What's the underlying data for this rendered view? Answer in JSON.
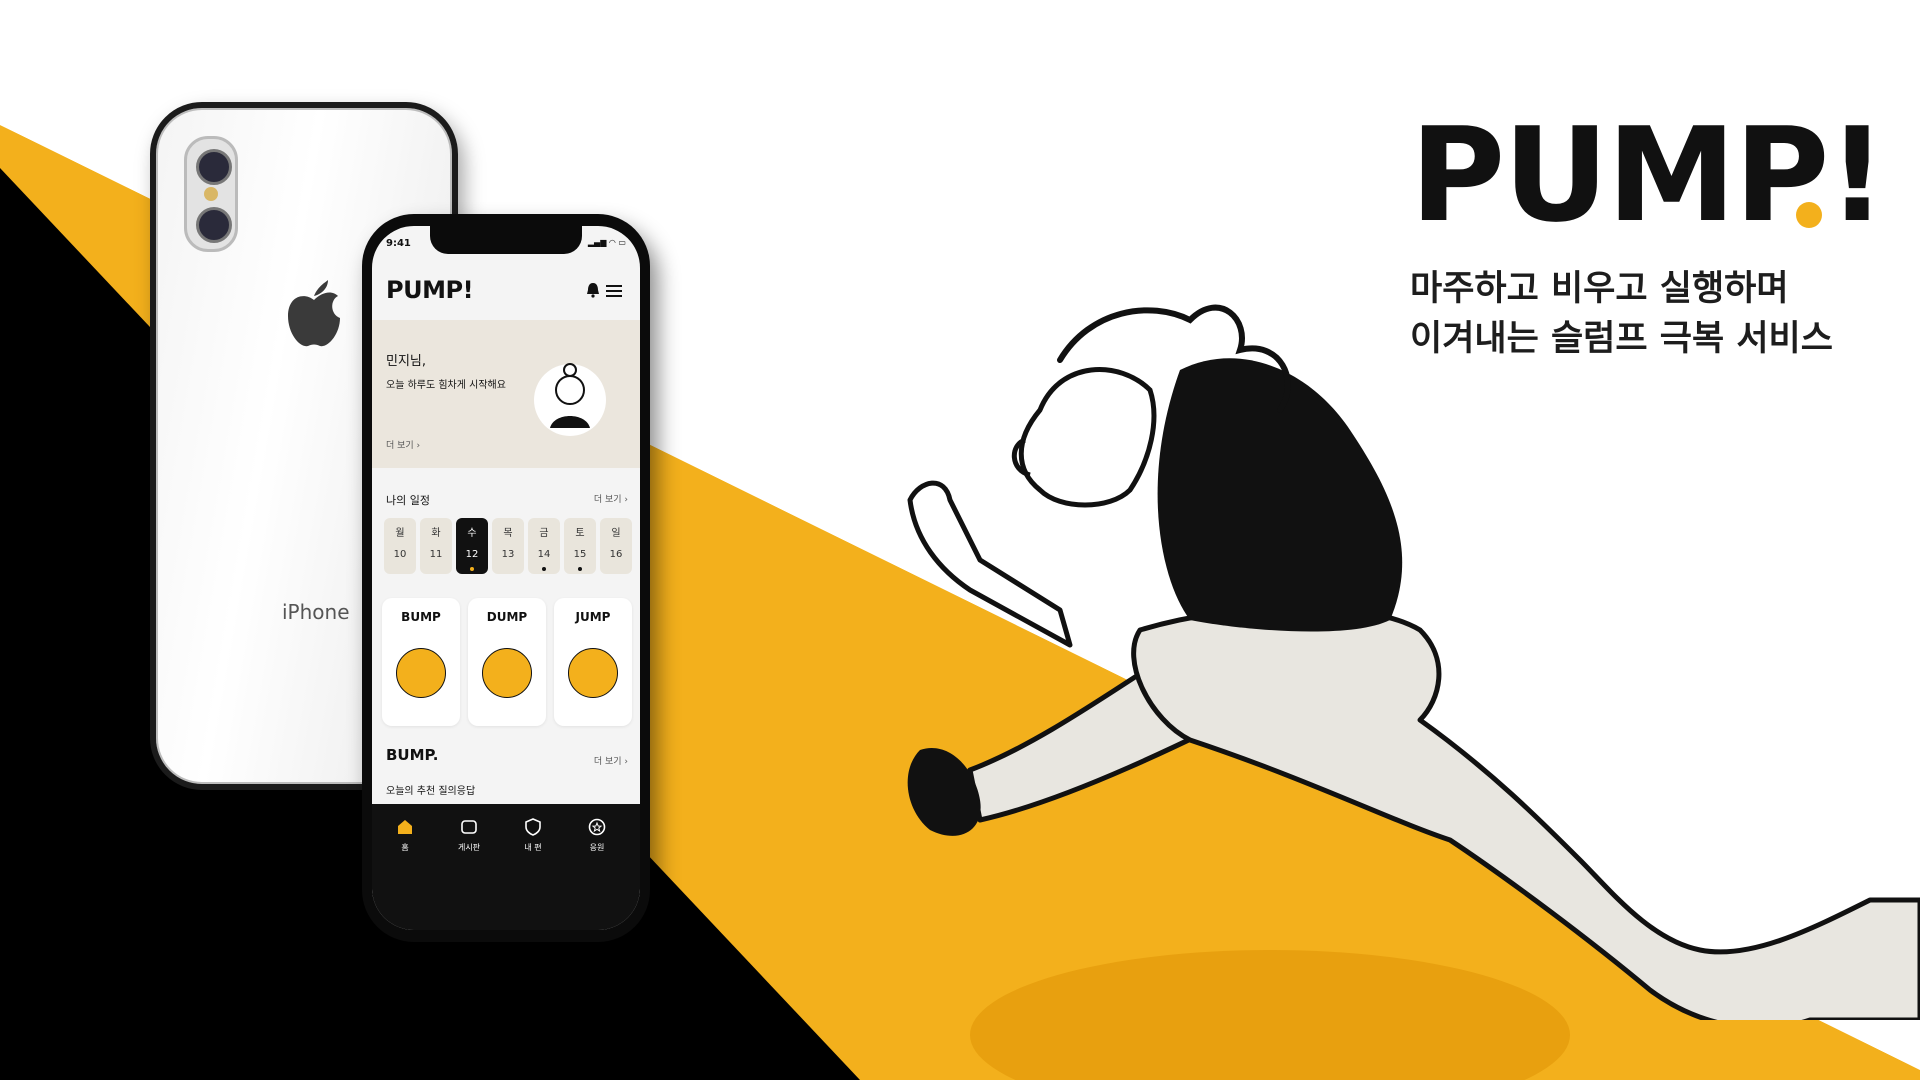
{
  "brand": {
    "logo": "PUMP",
    "logo_mark": "!",
    "tagline_line1": "마주하고 비우고 실행하며",
    "tagline_line2": "이겨내는 슬럼프 극복 서비스"
  },
  "colors": {
    "accent": "#f3b01c",
    "ink": "#111111",
    "cream": "#ebe6dd"
  },
  "back_phone": {
    "label": "iPhone"
  },
  "app": {
    "status_time": "9:41",
    "logo": "PUMP",
    "logo_mark": "!",
    "greeting": {
      "name": "민지님,",
      "message": "오늘 하루도 힘차게 시작해요",
      "more": "더 보기 ›"
    },
    "schedule": {
      "title": "나의 일정",
      "more": "더 보기 ›",
      "days": [
        {
          "name": "월",
          "num": "10",
          "dot": false,
          "active": false
        },
        {
          "name": "화",
          "num": "11",
          "dot": false,
          "active": false
        },
        {
          "name": "수",
          "num": "12",
          "dot": true,
          "active": true
        },
        {
          "name": "목",
          "num": "13",
          "dot": false,
          "active": false
        },
        {
          "name": "금",
          "num": "14",
          "dot": true,
          "active": false
        },
        {
          "name": "토",
          "num": "15",
          "dot": true,
          "active": false
        },
        {
          "name": "일",
          "num": "16",
          "dot": false,
          "active": false
        }
      ]
    },
    "features": [
      {
        "label": "BUMP",
        "icon": "people-illustration-icon"
      },
      {
        "label": "DUMP",
        "icon": "trash-can-icon"
      },
      {
        "label": "JUMP",
        "icon": "runner-icon"
      }
    ],
    "bump_section": {
      "title": "BUMP.",
      "more": "더 보기 ›",
      "subtitle": "오늘의 추천 질의응답"
    },
    "tabs": [
      {
        "label": "홈",
        "icon": "home-icon"
      },
      {
        "label": "게시판",
        "icon": "board-icon"
      },
      {
        "label": "내 편",
        "icon": "shield-icon"
      },
      {
        "label": "응원",
        "icon": "star-badge-icon"
      }
    ]
  }
}
